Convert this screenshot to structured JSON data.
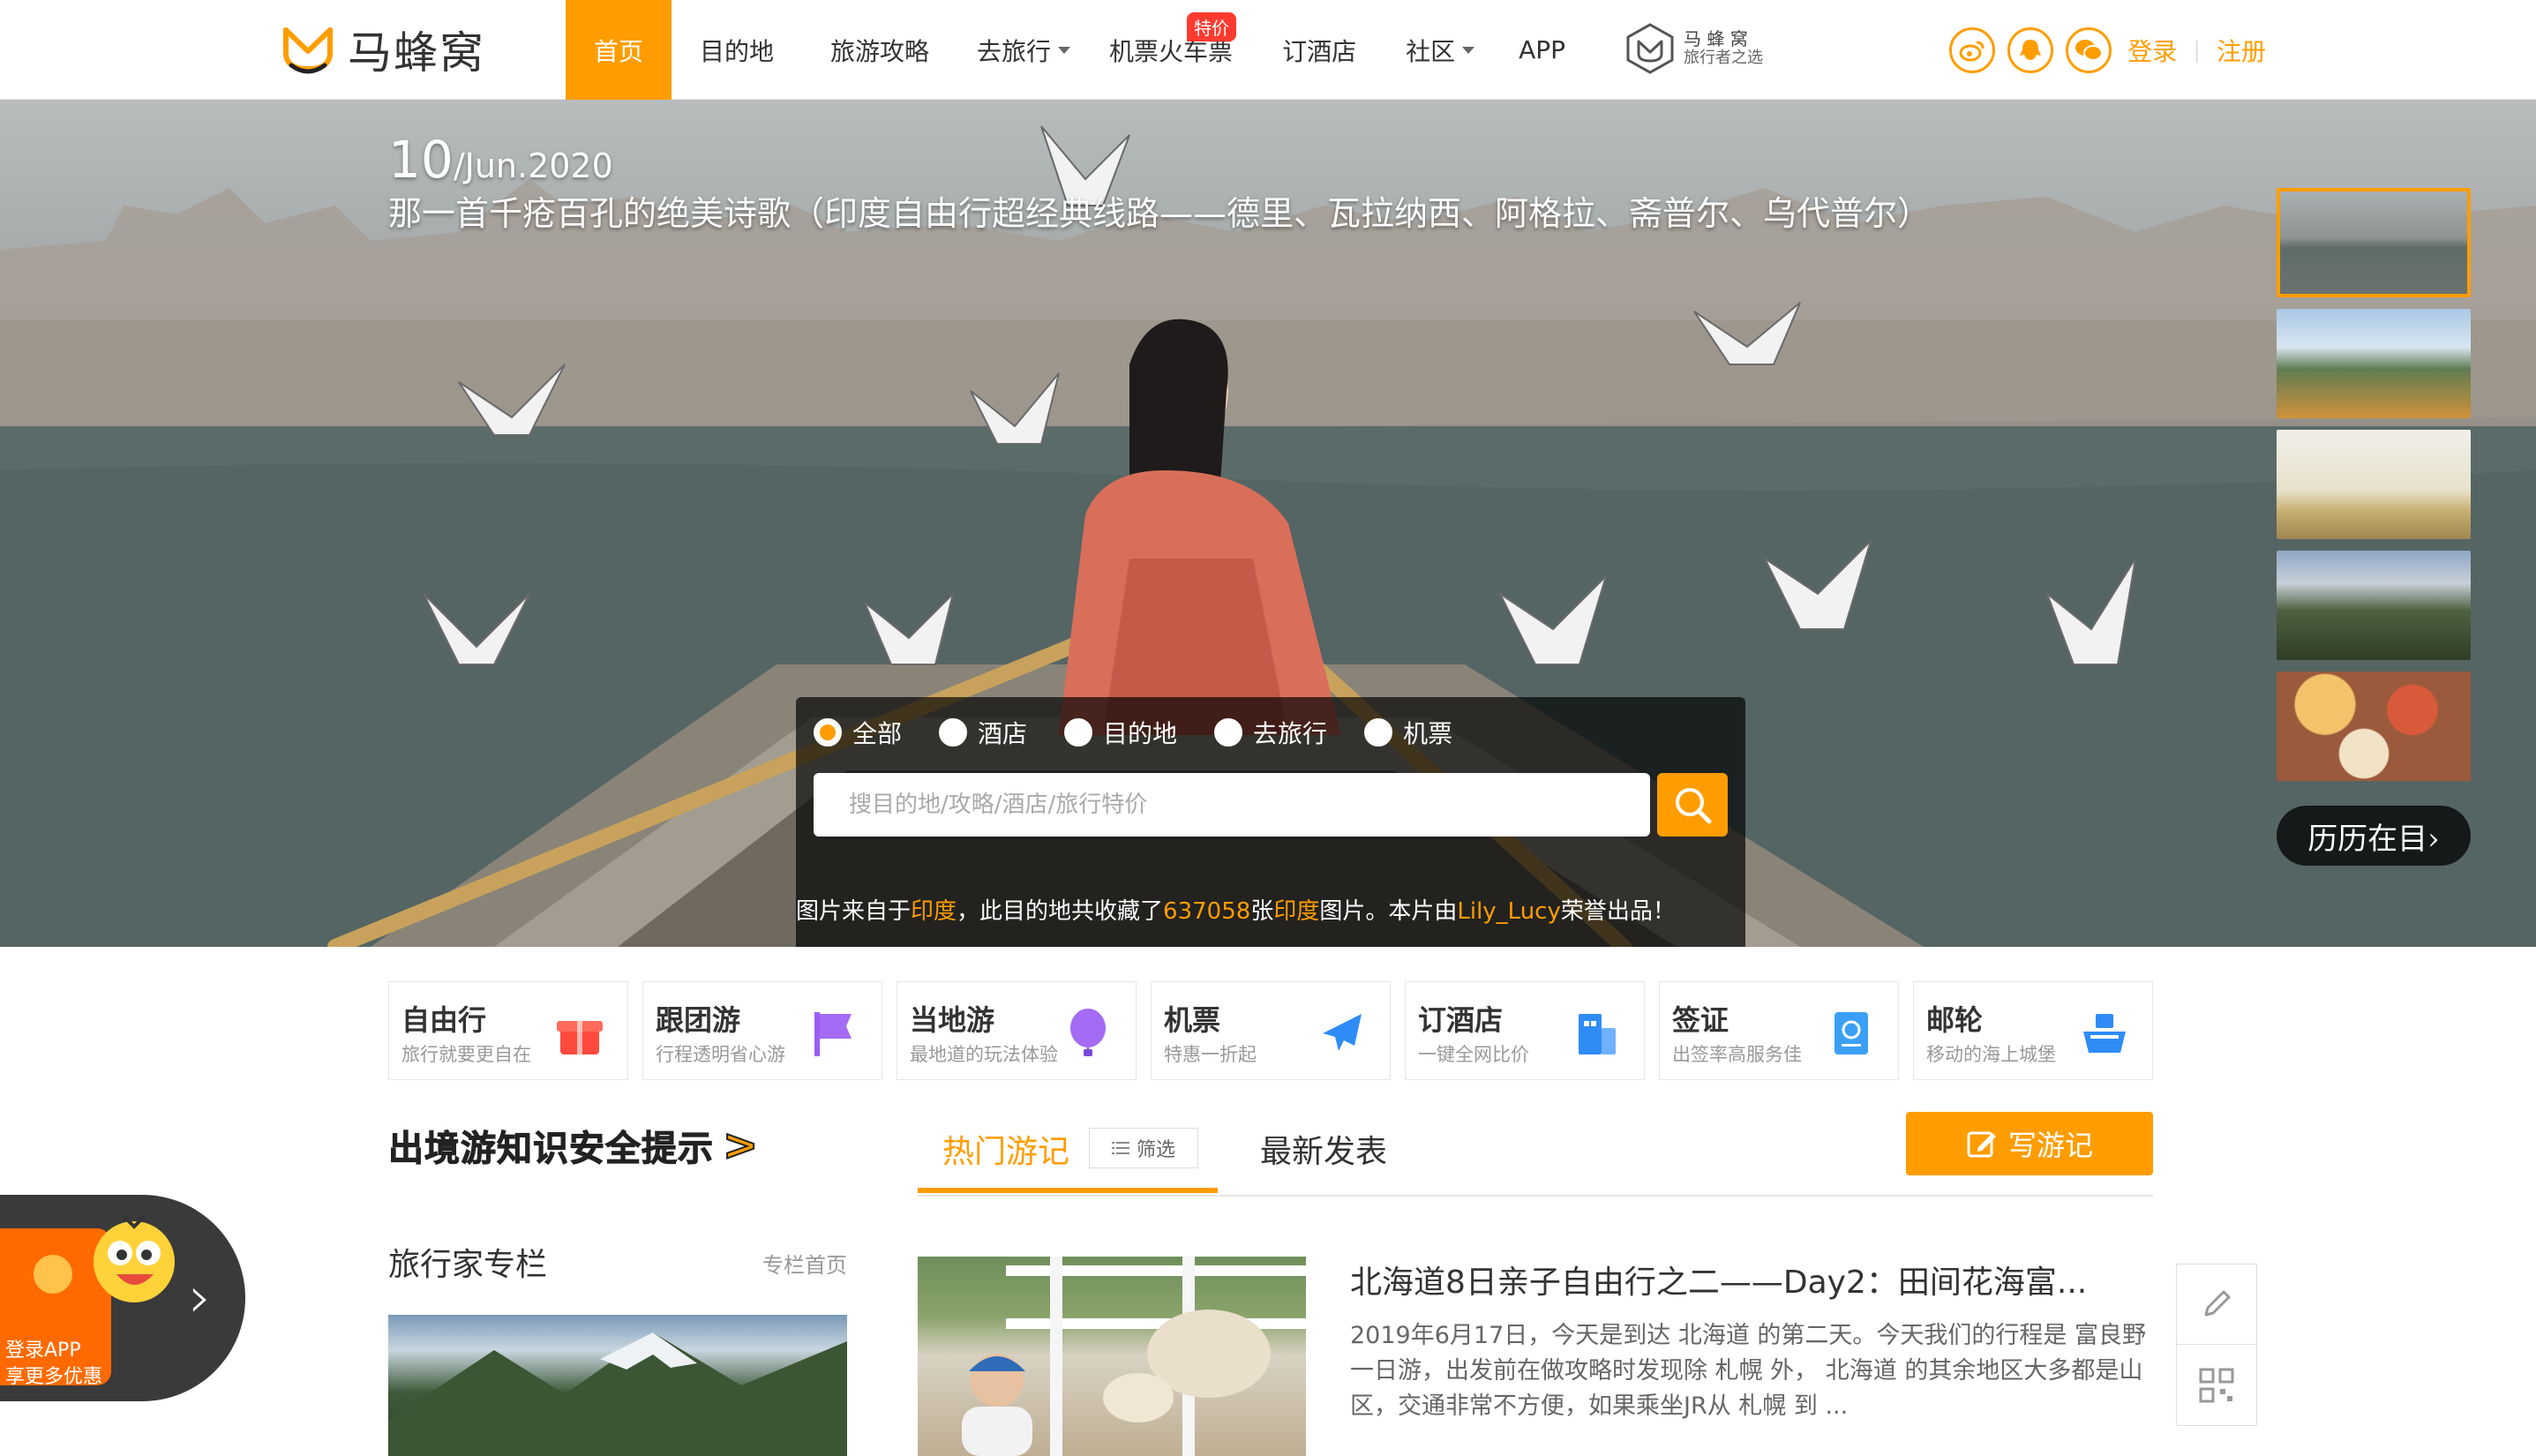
{
  "header": {
    "logo_text": "马蜂窝",
    "nav": [
      {
        "label": "首页",
        "active": true
      },
      {
        "label": "目的地"
      },
      {
        "label": "旅游攻略"
      },
      {
        "label": "去旅行",
        "dropdown": true
      },
      {
        "label": "机票火车票",
        "badge": "特价"
      },
      {
        "label": "订酒店"
      },
      {
        "label": "社区",
        "dropdown": true
      },
      {
        "label": "APP"
      }
    ],
    "slogan_line1": "马 蜂 窝",
    "slogan_line2": "旅行者之选",
    "social_icons": [
      "weibo-icon",
      "qq-icon",
      "wechat-icon"
    ],
    "login": "登录",
    "separator": "|",
    "register": "注册"
  },
  "hero": {
    "date_day": "10",
    "date_rest": "/Jun.2020",
    "title": "那一首千疮百孔的绝美诗歌（印度自由行超经典线路——德里、瓦拉纳西、阿格拉、斋普尔、乌代普尔）",
    "eyes_button": "历历在目›",
    "thumbnails": [
      "boat",
      "lakeside",
      "pier",
      "hills",
      "food"
    ]
  },
  "search": {
    "options": [
      {
        "label": "全部",
        "checked": true
      },
      {
        "label": "酒店"
      },
      {
        "label": "目的地"
      },
      {
        "label": "去旅行"
      },
      {
        "label": "机票"
      }
    ],
    "placeholder": "搜目的地/攻略/酒店/旅行特价",
    "credit": {
      "p1": "图片来自于",
      "place": "印度",
      "p2": "，此目的地共收藏了",
      "count": "637058",
      "p3": "张",
      "place2": "印度",
      "p4": "图片。本片由",
      "author": "Lily_Lucy",
      "p5": "荣誉出品！"
    }
  },
  "services": [
    {
      "title": "自由行",
      "subtitle": "旅行就要更自在",
      "icon": "gift-icon",
      "color": "#ff4a3d"
    },
    {
      "title": "跟团游",
      "subtitle": "行程透明省心游",
      "icon": "flag-icon",
      "color": "#9b5cf6"
    },
    {
      "title": "当地游",
      "subtitle": "最地道的玩法体验",
      "icon": "balloon-icon",
      "color": "#a46bf5"
    },
    {
      "title": "机票",
      "subtitle": "特惠一折起",
      "icon": "plane-icon",
      "color": "#2f8cf6"
    },
    {
      "title": "订酒店",
      "subtitle": "一键全网比价",
      "icon": "building-icon",
      "color": "#2f8cf6"
    },
    {
      "title": "签证",
      "subtitle": "出签率高服务佳",
      "icon": "passport-icon",
      "color": "#3aa0f5"
    },
    {
      "title": "邮轮",
      "subtitle": "移动的海上城堡",
      "icon": "ship-icon",
      "color": "#2f8cf6"
    }
  ],
  "safety_banner": "出境游知识安全提示",
  "safety_arrow": ">",
  "tabs": {
    "hot": "热门游记",
    "filter": "筛选",
    "latest": "最新发表",
    "write": "写游记"
  },
  "column": {
    "title": "旅行家专栏",
    "link": "专栏首页"
  },
  "article": {
    "title": "北海道8日亲子自由行之二——Day2：田间花海富...",
    "excerpt": "2019年6月17日，今天是到达 北海道 的第二天。今天我们的行程是 富良野 一日游，出发前在做攻略时发现除 札幌 外， 北海道 的其余地区大多都是山区，交通非常不方便，如果乘坐JR从 札幌 到 ..."
  },
  "app_promo": {
    "line1": "登录APP",
    "line2": "享更多优惠"
  },
  "colors": {
    "accent": "#ff9d00",
    "badge": "#ff3b30",
    "text": "#333333"
  }
}
